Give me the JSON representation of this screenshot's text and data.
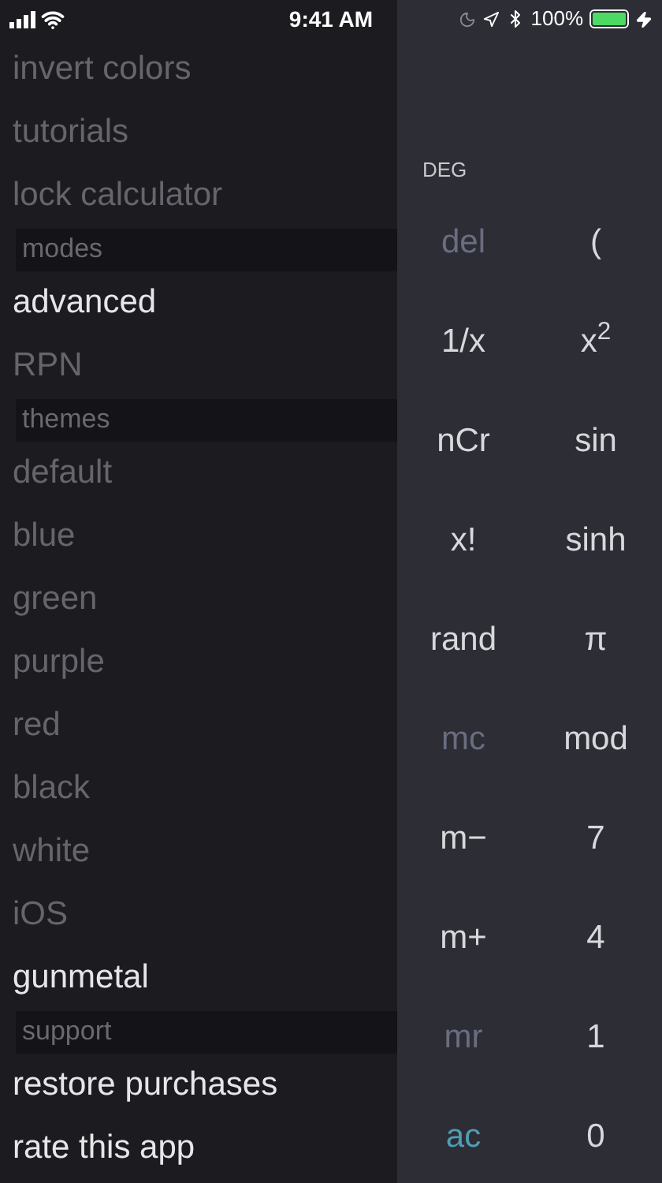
{
  "status_bar": {
    "time": "9:41 AM",
    "battery": "100%"
  },
  "menu": [
    {
      "kind": "action",
      "label": "invert colors",
      "disabled": true
    },
    {
      "kind": "action",
      "label": "tutorials",
      "disabled": true
    },
    {
      "kind": "action",
      "label": "lock calculator",
      "disabled": true
    },
    {
      "kind": "header",
      "label": "modes"
    },
    {
      "kind": "option",
      "label": "advanced",
      "selected": true
    },
    {
      "kind": "option",
      "label": "RPN",
      "selected": false
    },
    {
      "kind": "header",
      "label": "themes"
    },
    {
      "kind": "option",
      "label": "default",
      "selected": false
    },
    {
      "kind": "option",
      "label": "blue",
      "selected": false
    },
    {
      "kind": "option",
      "label": "green",
      "selected": false
    },
    {
      "kind": "option",
      "label": "purple",
      "selected": false
    },
    {
      "kind": "option",
      "label": "red",
      "selected": false
    },
    {
      "kind": "option",
      "label": "black",
      "selected": false
    },
    {
      "kind": "option",
      "label": "white",
      "selected": false
    },
    {
      "kind": "option",
      "label": "iOS",
      "selected": false
    },
    {
      "kind": "option",
      "label": "gunmetal",
      "selected": true
    },
    {
      "kind": "header",
      "label": "support"
    },
    {
      "kind": "action",
      "label": "restore purchases",
      "disabled": false
    },
    {
      "kind": "action",
      "label": "rate this app",
      "disabled": false
    }
  ],
  "calculator": {
    "angle_mode": "DEG",
    "keys": [
      {
        "label": "del",
        "kind": "disabled"
      },
      {
        "label": "(",
        "kind": "normal"
      },
      {
        "label": "1/x",
        "kind": "normal"
      },
      {
        "label": "x$^{2}$",
        "kind": "normal"
      },
      {
        "label": "nCr",
        "kind": "normal"
      },
      {
        "label": "sin",
        "kind": "normal"
      },
      {
        "label": "x!",
        "kind": "normal"
      },
      {
        "label": "sinh",
        "kind": "normal"
      },
      {
        "label": "rand",
        "kind": "normal"
      },
      {
        "label": "π",
        "kind": "normal"
      },
      {
        "label": "mc",
        "kind": "disabled"
      },
      {
        "label": "mod",
        "kind": "normal"
      },
      {
        "label": "m−",
        "kind": "normal"
      },
      {
        "label": "7",
        "kind": "normal"
      },
      {
        "label": "m+",
        "kind": "normal"
      },
      {
        "label": "4",
        "kind": "normal"
      },
      {
        "label": "mr",
        "kind": "disabled"
      },
      {
        "label": "1",
        "kind": "normal"
      },
      {
        "label": "ac",
        "kind": "accent"
      },
      {
        "label": "0",
        "kind": "normal"
      }
    ]
  }
}
